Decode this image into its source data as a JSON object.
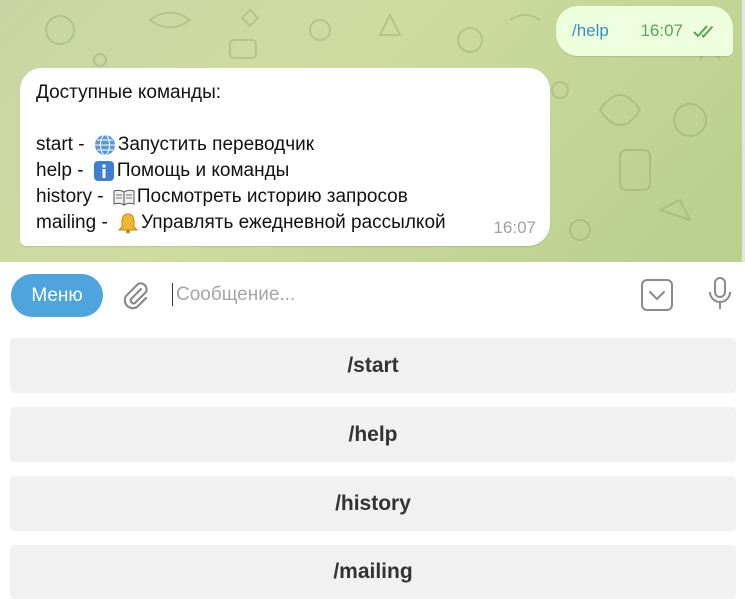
{
  "outgoing_message": {
    "text": "/help",
    "time": "16:07",
    "status_icon": "double-check-icon"
  },
  "incoming_message": {
    "header": "Доступные команды:",
    "commands": [
      {
        "name": "start",
        "sep": " - ",
        "icon": "globe-emoji",
        "desc": "Запустить переводчик"
      },
      {
        "name": "help",
        "sep": " - ",
        "icon": "info-emoji",
        "desc": "Помощь и команды"
      },
      {
        "name": "history",
        "sep": " - ",
        "icon": "book-emoji",
        "desc": "Посмотреть историю запросов"
      },
      {
        "name": "mailing",
        "sep": " - ",
        "icon": "bell-emoji",
        "desc": "Управлять ежедневной рассылкой"
      }
    ],
    "time": "16:07"
  },
  "input_bar": {
    "menu_label": "Меню",
    "placeholder": "Сообщение...",
    "attach_icon": "paperclip-icon",
    "keyboard_icon": "keyboard-toggle-icon",
    "mic_icon": "microphone-icon"
  },
  "keyboard": {
    "buttons": [
      "/start",
      "/help",
      "/history",
      "/mailing"
    ]
  },
  "colors": {
    "accent": "#4ea4dc",
    "outgoing_bubble": "#eeffde",
    "outgoing_text": "#3a8ec3",
    "outgoing_time": "#5aa35a",
    "keyboard_button": "#f1f1f1"
  }
}
